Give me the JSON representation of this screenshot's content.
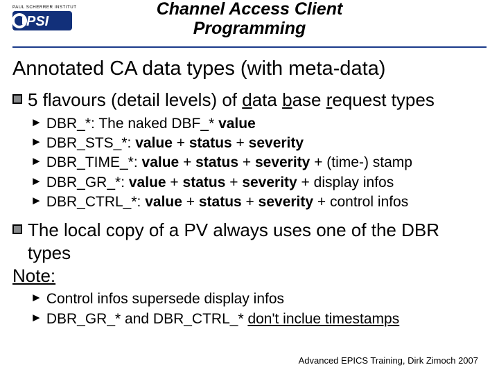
{
  "header": {
    "institute_top": "PAUL SCHERRER INSTITUT",
    "logo_text": "PSI",
    "title_l1": "Channel Access Client",
    "title_l2": "Programming"
  },
  "section_title": "Annotated CA data types (with meta-data)",
  "b1": {
    "pre": "5 flavours (detail levels) of ",
    "d": "d",
    "ata": "ata ",
    "b": "b",
    "ase": "ase ",
    "r": "r",
    "equest": "equest types"
  },
  "s1": {
    "label": "DBR_*: ",
    "a": "The naked DBF_* ",
    "v": "value"
  },
  "s2": {
    "label": "DBR_STS_*: ",
    "v": "value",
    "p": " + ",
    "st": "status",
    "sv": "severity"
  },
  "s3": {
    "label": "DBR_TIME_*: ",
    "v": "value",
    "p": " + ",
    "st": "status",
    "sv": "severity",
    "tail": " + (time-) stamp"
  },
  "s4": {
    "label": "DBR_GR_*: ",
    "v": "value",
    "p": " + ",
    "st": "status",
    "sv": "severity",
    "tail": " + display infos"
  },
  "s5": {
    "label": "DBR_CTRL_*: ",
    "v": "value",
    "p": " + ",
    "st": "status",
    "sv": "severity",
    "tail": " + control infos"
  },
  "b2": "The local copy of a PV always uses one of the DBR types",
  "note_label": "Note:",
  "n1": "Control infos supersede display infos",
  "n2": {
    "a": "DBR_GR_* and DBR_CTRL_* ",
    "b": "don't inclue timestamps"
  },
  "footer": "Advanced EPICS Training, Dirk Zimoch 2007"
}
